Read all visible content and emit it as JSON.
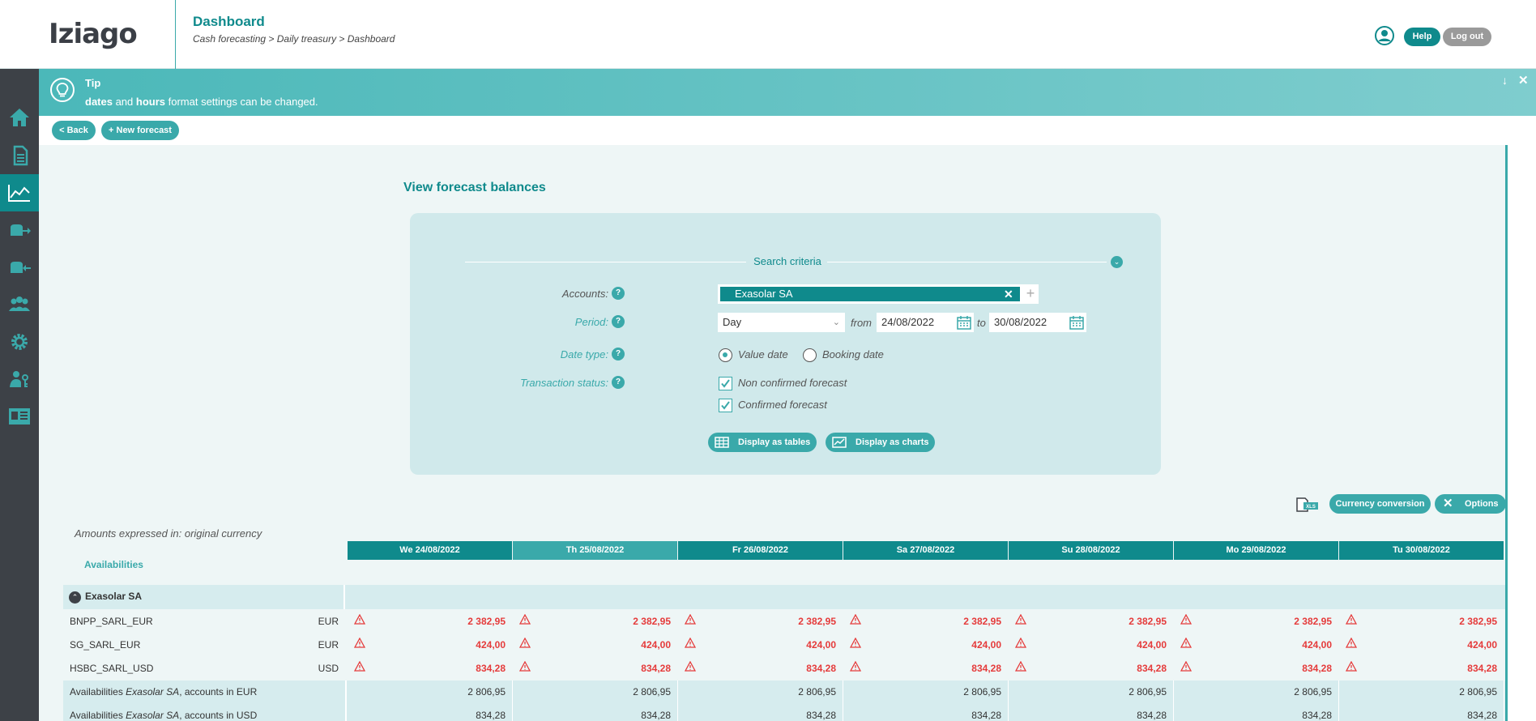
{
  "header": {
    "logo": "Iziago",
    "title": "Dashboard",
    "breadcrumb": "Cash forecasting > Daily treasury > Dashboard",
    "help_label": "Help",
    "logout_label": "Log out"
  },
  "sidebar": {
    "items": [
      {
        "icon": "home-icon"
      },
      {
        "icon": "document-icon"
      },
      {
        "icon": "chart-icon",
        "active": true
      },
      {
        "icon": "money-out-icon"
      },
      {
        "icon": "money-in-icon"
      },
      {
        "icon": "users-icon"
      },
      {
        "icon": "gear-icon"
      },
      {
        "icon": "user-key-icon"
      },
      {
        "icon": "id-card-icon"
      }
    ]
  },
  "tip": {
    "title": "Tip",
    "text_parts": [
      "dates",
      " and ",
      "hours",
      " format settings can be changed."
    ]
  },
  "actions": {
    "back_label": "< Back",
    "new_forecast_label": "+ New forecast"
  },
  "main": {
    "title": "View forecast balances"
  },
  "search": {
    "section_title": "Search criteria",
    "accounts_label": "Accounts:",
    "accounts_value": "Exasolar SA",
    "period_label": "Period:",
    "period_value": "Day",
    "from_label": "from",
    "from_value": "24/08/2022",
    "to_label": "to",
    "to_value": "30/08/2022",
    "date_type_label": "Date type:",
    "date_type_options": [
      "Value date",
      "Booking date"
    ],
    "date_type_selected": "Value date",
    "status_label": "Transaction status:",
    "status_options": [
      "Non confirmed forecast",
      "Confirmed forecast"
    ],
    "display_tables_label": "Display as tables",
    "display_charts_label": "Display as charts"
  },
  "tools": {
    "currency_conversion_label": "Currency conversion",
    "options_label": "Options",
    "xls_label": "XLS"
  },
  "table": {
    "amounts_note": "Amounts expressed in: original currency",
    "section_label": "Availabilities",
    "columns": [
      "We 24/08/2022",
      "Th 25/08/2022",
      "Fr 26/08/2022",
      "Sa 27/08/2022",
      "Su 28/08/2022",
      "Mo 29/08/2022",
      "Tu 30/08/2022"
    ],
    "highlight_column": 1,
    "group_name": "Exasolar SA",
    "accounts": [
      {
        "name": "BNPP_SARL_EUR",
        "currency": "EUR",
        "values": [
          "2 382,95",
          "2 382,95",
          "2 382,95",
          "2 382,95",
          "2 382,95",
          "2 382,95",
          "2 382,95"
        ]
      },
      {
        "name": "SG_SARL_EUR",
        "currency": "EUR",
        "values": [
          "424,00",
          "424,00",
          "424,00",
          "424,00",
          "424,00",
          "424,00",
          "424,00"
        ]
      },
      {
        "name": "HSBC_SARL_USD",
        "currency": "USD",
        "values": [
          "834,28",
          "834,28",
          "834,28",
          "834,28",
          "834,28",
          "834,28",
          "834,28"
        ]
      }
    ],
    "subtotals": [
      {
        "prefix": "Availabilities ",
        "entity": "Exasolar SA",
        "suffix": ", accounts in EUR",
        "values": [
          "2 806,95",
          "2 806,95",
          "2 806,95",
          "2 806,95",
          "2 806,95",
          "2 806,95",
          "2 806,95"
        ]
      },
      {
        "prefix": "Availabilities ",
        "entity": "Exasolar SA",
        "suffix": ", accounts in USD",
        "values": [
          "834,28",
          "834,28",
          "834,28",
          "834,28",
          "834,28",
          "834,28",
          "834,28"
        ]
      }
    ]
  },
  "colors": {
    "brand_teal": "#0f8a8c",
    "accent_teal": "#3aa9aa",
    "sidebar": "#3d4147",
    "negative_red": "#e53b3b"
  }
}
